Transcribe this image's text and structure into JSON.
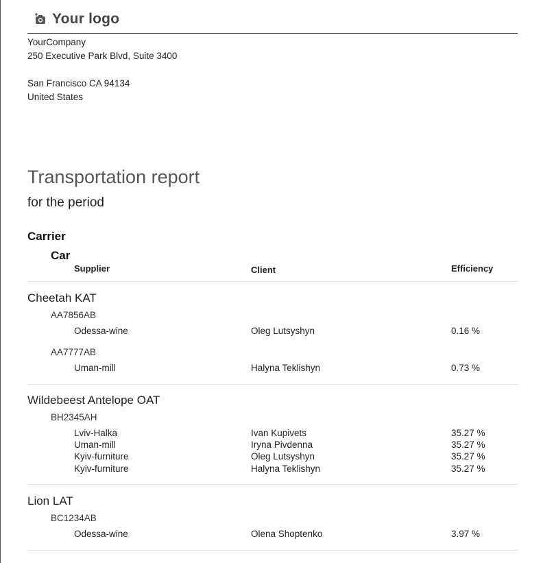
{
  "logo": {
    "text": "Your logo",
    "icon": "camera-icon"
  },
  "company": {
    "name": "YourCompany",
    "street": "250 Executive Park Blvd, Suite 3400",
    "city": "San Francisco CA 94134",
    "country": "United States"
  },
  "report": {
    "title": "Transportation report",
    "subtitle": "for the period"
  },
  "table_headers": {
    "carrier": "Carrier",
    "car": "Car",
    "supplier": "Supplier",
    "client": "Client",
    "efficiency": "Efficiency"
  },
  "carriers": [
    {
      "name": "Cheetah KAT",
      "cars": [
        {
          "plate": "AA7856AB",
          "rows": [
            {
              "supplier": "Odessa-wine",
              "client": "Oleg Lutsyshyn",
              "efficiency": "0.16 %"
            }
          ]
        },
        {
          "plate": "AA7777AB",
          "rows": [
            {
              "supplier": "Uman-mill",
              "client": "Halyna Teklishyn",
              "efficiency": "0.73 %"
            }
          ]
        }
      ]
    },
    {
      "name": "Wildebeest Antelope OAT",
      "cars": [
        {
          "plate": "BH2345AH",
          "rows": [
            {
              "supplier": "Lviv-Halka",
              "client": "Ivan Kupivets",
              "efficiency": "35.27 %"
            },
            {
              "supplier": "Uman-mill",
              "client": "Iryna Pivdenna",
              "efficiency": "35.27 %"
            },
            {
              "supplier": "Kyiv-furniture",
              "client": "Oleg Lutsyshyn",
              "efficiency": "35.27 %"
            },
            {
              "supplier": "Kyiv-furniture",
              "client": "Halyna Teklishyn",
              "efficiency": "35.27 %"
            }
          ]
        }
      ]
    },
    {
      "name": "Lion LAT",
      "cars": [
        {
          "plate": "BC1234AB",
          "rows": [
            {
              "supplier": "Odessa-wine",
              "client": "Olena Shoptenko",
              "efficiency": "3.97 %"
            }
          ]
        }
      ]
    }
  ]
}
